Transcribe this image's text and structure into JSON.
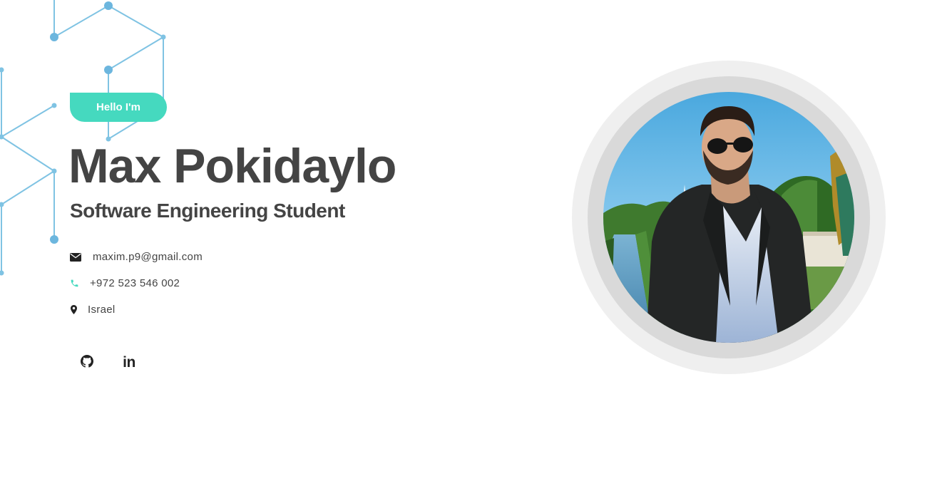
{
  "hero": {
    "greeting": "Hello I'm",
    "name": "Max Pokidaylo",
    "title": "Software Engineering Student"
  },
  "contacts": {
    "email": {
      "icon": "envelope-icon",
      "text": "maxim.p9@gmail.com"
    },
    "phone": {
      "icon": "phone-icon",
      "text": "+972 523 546 002"
    },
    "location": {
      "icon": "map-marker-icon",
      "text": "Israel"
    }
  },
  "social": {
    "github": {
      "icon": "github-icon"
    },
    "linkedin": {
      "icon": "linkedin-icon",
      "glyph": "in"
    }
  },
  "colors": {
    "accent": "#45d9bf",
    "heading": "#444444",
    "hex_lines": "#7fc3e3",
    "ring_outer": "#efefef",
    "ring_inner": "#d9d9d9"
  }
}
